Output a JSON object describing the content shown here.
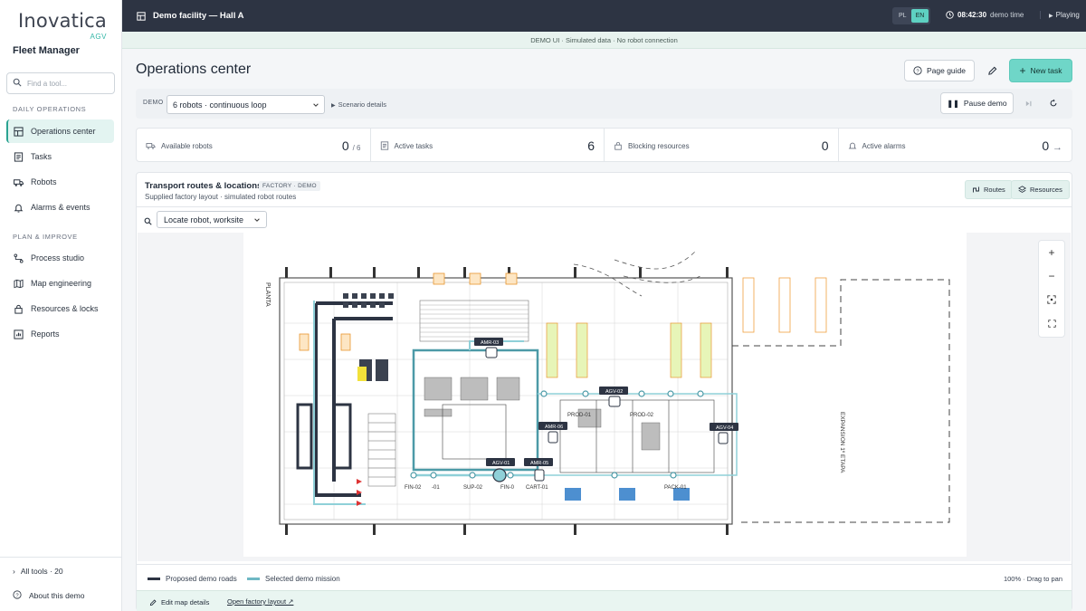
{
  "brand": {
    "name": "Inovatica",
    "sub": "AGV",
    "app": "Fleet Manager"
  },
  "search": {
    "placeholder": "Find a tool..."
  },
  "sidebar": {
    "section_daily": "DAILY OPERATIONS",
    "section_plan": "PLAN & IMPROVE",
    "items": [
      {
        "label": "Operations center",
        "icon": "layout-icon",
        "active": true
      },
      {
        "label": "Tasks",
        "icon": "list-icon"
      },
      {
        "label": "Robots",
        "icon": "truck-icon"
      },
      {
        "label": "Alarms & events",
        "icon": "bell-icon"
      },
      {
        "label": "Process studio",
        "icon": "flow-icon"
      },
      {
        "label": "Map engineering",
        "icon": "map-icon"
      },
      {
        "label": "Resources & locks",
        "icon": "lock-icon"
      },
      {
        "label": "Reports",
        "icon": "chart-icon"
      }
    ],
    "all_tools": "All tools · 20",
    "about": "About this demo"
  },
  "topbar": {
    "title": "Demo facility — Hall A",
    "lang": [
      "PL",
      "EN"
    ],
    "lang_active": "EN",
    "time": "08:42:30",
    "time_label": "demo time",
    "playing": "Playing"
  },
  "banner": "DEMO UI · Simulated data · No robot connection",
  "page": {
    "title": "Operations center",
    "page_guide": "Page guide",
    "new_task": "New task"
  },
  "demo_bar": {
    "tag": "DEMO",
    "scenario": "6 robots · continuous loop",
    "details": "Scenario details",
    "pause": "Pause demo"
  },
  "stats": [
    {
      "label": "Available robots",
      "value": "0",
      "suffix": "/ 6"
    },
    {
      "label": "Active tasks",
      "value": "6",
      "suffix": ""
    },
    {
      "label": "Blocking resources",
      "value": "0",
      "suffix": ""
    },
    {
      "label": "Active alarms",
      "value": "0",
      "suffix": ""
    }
  ],
  "map": {
    "title": "Transport routes & locations",
    "tag": "FACTORY · DEMO",
    "subtitle": "Supplied factory layout · simulated robot routes",
    "routes_btn": "Routes",
    "resources_btn": "Resources",
    "locate": "Locate robot, worksite",
    "labels": {
      "planta": "PLANTA",
      "expansion": "EXPANSION 1º ETAPA",
      "robots": [
        "AMR-03",
        "AGV-02",
        "AMR-06",
        "AGV-04",
        "AGV-01",
        "AMR-05"
      ],
      "stations": [
        "FIN-02",
        "-01",
        "SUP-02",
        "FIN-0",
        "CART-01",
        "PROD-01",
        "PROD-02",
        "PACK-01"
      ]
    },
    "legend_proposed": "Proposed demo roads",
    "legend_selected": "Selected demo mission",
    "zoom_note": "100% · Drag to pan",
    "edit_details": "Edit map details",
    "open_layout": "Open factory layout ↗"
  },
  "colors": {
    "accent": "#5ed1c2",
    "road": "#2d3443",
    "mission": "#6fb8c4",
    "dock": "#f0a040"
  }
}
